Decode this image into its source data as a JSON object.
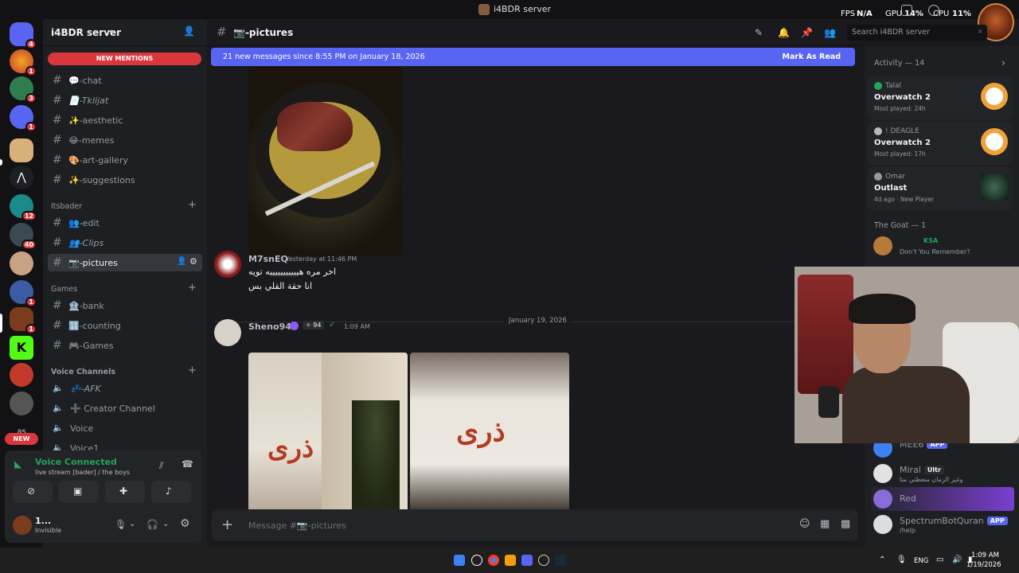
{
  "window": {
    "title": "i4BDR server",
    "fps_label": "FPS",
    "fps_value": "N/A",
    "gpu_label": "GPU",
    "gpu_value": "14%",
    "cpu_label": "CPU",
    "cpu_value": "11%"
  },
  "rail": {
    "badges": [
      "4",
      "1",
      "3",
      "1",
      "12",
      "40",
      "1",
      "1"
    ],
    "new_label": "NEW"
  },
  "server": {
    "name": "i4BDR server",
    "new_mentions": "NEW MENTIONS"
  },
  "channels": {
    "top": [
      {
        "label": "💬-chat"
      },
      {
        "label": "📄-Tklijat"
      },
      {
        "label": "✨-aesthetic"
      },
      {
        "label": "😂-memes"
      },
      {
        "label": "🎨-art-gallery"
      },
      {
        "label": "✨-suggestions"
      }
    ],
    "cat_itsbader": "Itsbader",
    "itsbader": [
      {
        "label": "👥-edit"
      },
      {
        "label": "👥-Clips"
      },
      {
        "label": "📷-pictures"
      }
    ],
    "cat_games": "Games",
    "games": [
      {
        "label": "🏦-bank"
      },
      {
        "label": "🔢-counting"
      },
      {
        "label": "🎮-Games"
      }
    ],
    "cat_voice": "Voice Channels",
    "voice": [
      {
        "label": "💤-AFK"
      },
      {
        "label": "➕ Creator Channel"
      },
      {
        "label": "Voice"
      },
      {
        "label": "Voice1"
      }
    ]
  },
  "voice_panel": {
    "status": "Voice Connected",
    "detail": "live stream [bader] / the boys",
    "user_name": "1...",
    "user_status": "Invisible"
  },
  "header": {
    "channel": "📷-pictures",
    "search_placeholder": "Search i4BDR server"
  },
  "banner": {
    "text": "21 new messages since 8:55 PM on January 18, 2026",
    "action": "Mark As Read"
  },
  "messages": [
    {
      "author": "M7snEQ",
      "time": "Yesterday at 11:46 PM",
      "lines": [
        "اخر مره هيييييييييييه تويه",
        "انا حقة القلي بس"
      ]
    },
    {
      "author": "Sheno94",
      "time": "1:09 AM",
      "tag": "94"
    }
  ],
  "date_divider": "January 19, 2026",
  "photo_logo": "ذرى",
  "input_placeholder": "Message #📷-pictures",
  "members": {
    "activity_header": "Activity — 14",
    "activities": [
      {
        "user": "Talal",
        "game": "Overwatch 2",
        "sub": "Most played: 24h"
      },
      {
        "user": "! DEAGLE",
        "game": "Overwatch 2",
        "sub": "Most played: 17h"
      },
      {
        "user": "Omar",
        "game": "Outlast",
        "sub": "4d ago · New Player"
      }
    ],
    "group_header": "The Goat — 1",
    "goat": {
      "tag": "KSA",
      "sub": "Don't You Remember?"
    },
    "list": [
      {
        "name": "MEE6",
        "tag": "APP"
      },
      {
        "name": "Miral",
        "tag": "Ultr",
        "sub": "وغير الزمان متعطتي متا"
      },
      {
        "name": "Red"
      },
      {
        "name": "SpectrumBotQuran",
        "tag": "APP",
        "sub": "/help"
      }
    ]
  },
  "taskbar": {
    "lang": "ENG",
    "time": "1:09 AM",
    "date": "1/19/2026"
  }
}
